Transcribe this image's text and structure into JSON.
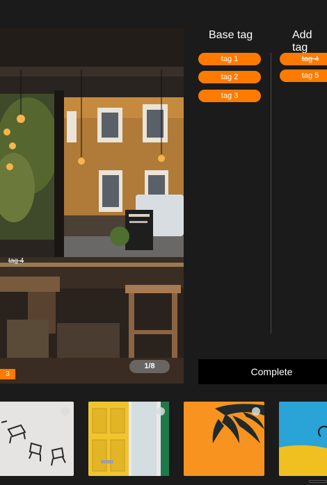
{
  "photo": {
    "image_tag_label": "tag 4",
    "image_tag_orange_label": "3",
    "counter": "1/8"
  },
  "tags": {
    "base_title": "Base tag",
    "add_title": "Add tag",
    "base_items": [
      "tag 1",
      "tag 2",
      "tag 3"
    ],
    "added_items": [
      "tag 4",
      "tag 5"
    ]
  },
  "complete_label": "Complete",
  "colors": {
    "accent": "#ff7a00",
    "background": "#1b1b1b",
    "button": "#000000"
  },
  "thumbnails": [
    {
      "name": "flying chairs"
    },
    {
      "name": "yellow door"
    },
    {
      "name": "orange pineapple"
    },
    {
      "name": "blue yellow wall"
    }
  ]
}
